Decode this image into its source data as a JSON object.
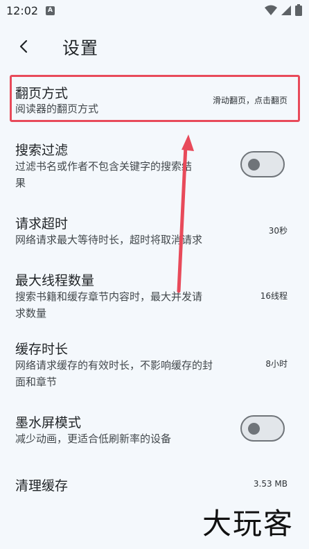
{
  "status": {
    "time": "12:02",
    "badge": "A"
  },
  "header": {
    "title": "设置"
  },
  "settings": {
    "page_turn": {
      "title": "翻页方式",
      "subtitle": "阅读器的翻页方式",
      "value": "滑动翻页，点击翻页"
    },
    "search_filter": {
      "title": "搜索过滤",
      "subtitle_line1": "过滤书名或作者不包含关键字的搜索结",
      "subtitle_line2": "果",
      "enabled": false
    },
    "request_timeout": {
      "title": "请求超时",
      "subtitle": "网络请求最大等待时长，超时将取消请求",
      "value": "30秒"
    },
    "max_threads": {
      "title": "最大线程数量",
      "subtitle_line1": "搜索书籍和缓存章节内容时，最大并发请",
      "subtitle_line2": "求数量",
      "value": "16线程"
    },
    "cache_duration": {
      "title": "缓存时长",
      "subtitle_line1": "网络请求缓存的有效时长，不影响缓存的封",
      "subtitle_line2": "面和章节",
      "value": "8小时"
    },
    "eink_mode": {
      "title": "墨水屏模式",
      "subtitle": "减少动画，更适合低刷新率的设备",
      "enabled": false
    },
    "clear_cache": {
      "title": "清理缓存",
      "value": "3.53 MB"
    }
  },
  "watermark": "大玩客",
  "colors": {
    "highlight": "#e84a5a",
    "arrow": "#e84a5a",
    "background": "#f4f8fc"
  }
}
